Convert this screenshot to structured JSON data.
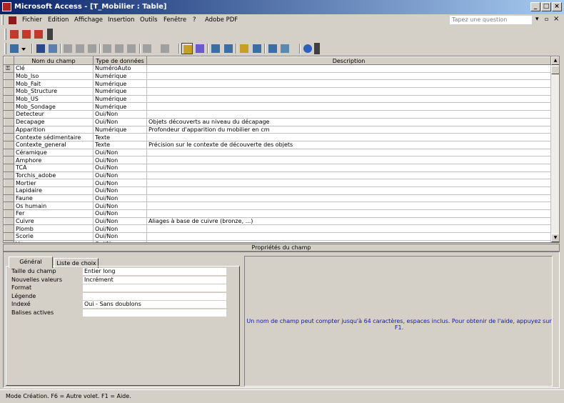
{
  "window": {
    "title": "Microsoft Access - [T_Mobilier : Table]"
  },
  "caption_buttons": {
    "minimize": "_",
    "maximize": "□",
    "close": "×"
  },
  "menu": [
    {
      "label": "Fichier"
    },
    {
      "label": "Edition"
    },
    {
      "label": "Affichage"
    },
    {
      "label": "Insertion"
    },
    {
      "label": "Outils"
    },
    {
      "label": "Fenêtre"
    },
    {
      "label": "?"
    },
    {
      "label": "Adobe PDF"
    }
  ],
  "ask": {
    "placeholder": "Tapez une question"
  },
  "grid": {
    "headers": [
      "Nom du champ",
      "Type de données",
      "Description"
    ],
    "rows": [
      {
        "name": "Clé",
        "type": "NuméroAuto",
        "desc": "",
        "key": true
      },
      {
        "name": "Mob_Iso",
        "type": "Numérique",
        "desc": ""
      },
      {
        "name": "Mob_Fait",
        "type": "Numérique",
        "desc": ""
      },
      {
        "name": "Mob_Structure",
        "type": "Numérique",
        "desc": ""
      },
      {
        "name": "Mob_US",
        "type": "Numérique",
        "desc": ""
      },
      {
        "name": "Mob_Sondage",
        "type": "Numérique",
        "desc": ""
      },
      {
        "name": "Detecteur",
        "type": "Oui/Non",
        "desc": ""
      },
      {
        "name": "Decapage",
        "type": "Oui/Non",
        "desc": "Objets découverts au niveau du décapage"
      },
      {
        "name": "Apparition",
        "type": "Numérique",
        "desc": "Profondeur d'apparition du mobilier en cm"
      },
      {
        "name": "Contexte sédimentaire",
        "type": "Texte",
        "desc": ""
      },
      {
        "name": "Contexte_general",
        "type": "Texte",
        "desc": "Précision sur le contexte de découverte des objets"
      },
      {
        "name": "Céramique",
        "type": "Oui/Non",
        "desc": ""
      },
      {
        "name": "Amphore",
        "type": "Oui/Non",
        "desc": ""
      },
      {
        "name": "TCA",
        "type": "Oui/Non",
        "desc": ""
      },
      {
        "name": "Torchis_adobe",
        "type": "Oui/Non",
        "desc": ""
      },
      {
        "name": "Mortier",
        "type": "Oui/Non",
        "desc": ""
      },
      {
        "name": "Lapidaire",
        "type": "Oui/Non",
        "desc": ""
      },
      {
        "name": "Faune",
        "type": "Oui/Non",
        "desc": ""
      },
      {
        "name": "Os humain",
        "type": "Oui/Non",
        "desc": ""
      },
      {
        "name": "Fer",
        "type": "Oui/Non",
        "desc": ""
      },
      {
        "name": "Cuivre",
        "type": "Oui/Non",
        "desc": "Aliages à base de cuivre (bronze, ...)"
      },
      {
        "name": "Plomb",
        "type": "Oui/Non",
        "desc": ""
      },
      {
        "name": "Scorie",
        "type": "Oui/Non",
        "desc": ""
      },
      {
        "name": "Verre",
        "type": "Oui/Non",
        "desc": ""
      }
    ]
  },
  "props": {
    "title": "Propriétés du champ",
    "tabs": [
      "Général",
      "Liste de choix"
    ],
    "rows": [
      {
        "label": "Taille du champ",
        "value": "Entier long"
      },
      {
        "label": "Nouvelles valeurs",
        "value": "Incrément"
      },
      {
        "label": "Format",
        "value": ""
      },
      {
        "label": "Légende",
        "value": ""
      },
      {
        "label": "Indexé",
        "value": "Oui - Sans doublons"
      },
      {
        "label": "Balises actives",
        "value": ""
      }
    ],
    "help": "Un nom de champ peut compter jusqu'à 64 caractères, espaces inclus. Pour obtenir de l'aide, appuyez sur F1."
  },
  "status": {
    "text": "Mode Création. F6 = Autre volet. F1 = Aide."
  }
}
